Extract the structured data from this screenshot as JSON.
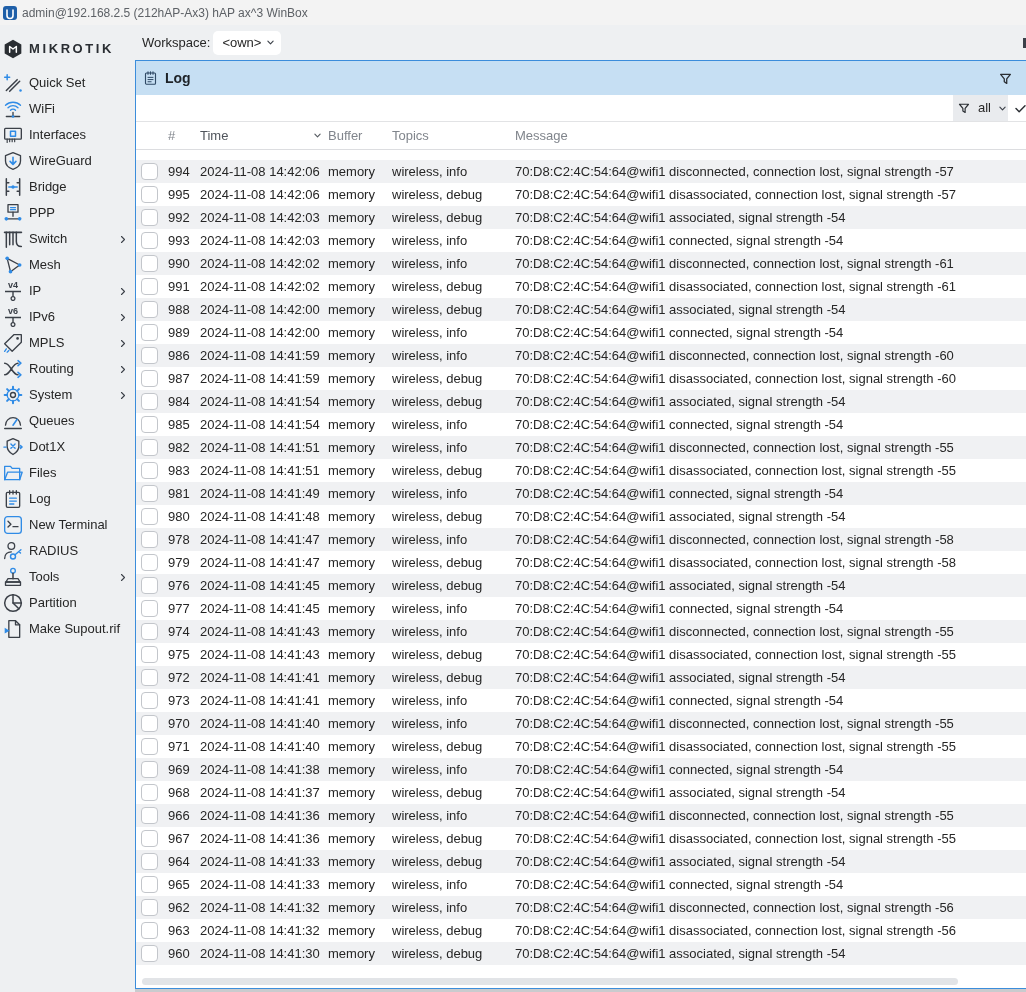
{
  "window": {
    "title": "admin@192.168.2.5 (212hAP-Ax3) hAP ax^3 WinBox"
  },
  "logo": {
    "text": "MIKROTIK"
  },
  "sidebar": {
    "items": [
      {
        "label": "Quick Set",
        "submenu": false,
        "selected": false
      },
      {
        "label": "WiFi",
        "submenu": false,
        "selected": false
      },
      {
        "label": "Interfaces",
        "submenu": false,
        "selected": false
      },
      {
        "label": "WireGuard",
        "submenu": false,
        "selected": false
      },
      {
        "label": "Bridge",
        "submenu": false,
        "selected": false
      },
      {
        "label": "PPP",
        "submenu": false,
        "selected": false
      },
      {
        "label": "Switch",
        "submenu": true,
        "selected": false
      },
      {
        "label": "Mesh",
        "submenu": false,
        "selected": false
      },
      {
        "label": "IP",
        "icon_text": "v4",
        "submenu": true,
        "selected": false
      },
      {
        "label": "IPv6",
        "icon_text": "v6",
        "submenu": true,
        "selected": false
      },
      {
        "label": "MPLS",
        "submenu": true,
        "selected": false
      },
      {
        "label": "Routing",
        "submenu": true,
        "selected": false
      },
      {
        "label": "System",
        "submenu": true,
        "selected": false
      },
      {
        "label": "Queues",
        "submenu": false,
        "selected": false
      },
      {
        "label": "Dot1X",
        "submenu": false,
        "selected": false
      },
      {
        "label": "Files",
        "submenu": false,
        "selected": false
      },
      {
        "label": "Log",
        "submenu": false,
        "selected": false
      },
      {
        "label": "New Terminal",
        "submenu": false,
        "selected": false
      },
      {
        "label": "RADIUS",
        "submenu": false,
        "selected": false
      },
      {
        "label": "Tools",
        "submenu": true,
        "selected": false
      },
      {
        "label": "Partition",
        "submenu": false,
        "selected": false
      },
      {
        "label": "Make Supout.rif",
        "submenu": false,
        "selected": false
      }
    ]
  },
  "workspace": {
    "label": "Workspace:",
    "value": "<own>"
  },
  "panel": {
    "title": "Log"
  },
  "filter": {
    "value": "all"
  },
  "table": {
    "columns": [
      {
        "label": "#",
        "sorted": false
      },
      {
        "label": "Time",
        "sorted": true
      },
      {
        "label": "Buffer",
        "sorted": false
      },
      {
        "label": "Topics",
        "sorted": false
      },
      {
        "label": "Message",
        "sorted": false
      }
    ],
    "rows": [
      {
        "number": "994",
        "time": "2024-11-08 14:42:06",
        "buffer": "memory",
        "topics": "wireless, info",
        "message": "70:D8:C2:4C:54:64@wifi1 disconnected, connection lost, signal strength -57",
        "checked": false
      },
      {
        "number": "995",
        "time": "2024-11-08 14:42:06",
        "buffer": "memory",
        "topics": "wireless, debug",
        "message": "70:D8:C2:4C:54:64@wifi1 disassociated, connection lost, signal strength -57",
        "checked": false
      },
      {
        "number": "992",
        "time": "2024-11-08 14:42:03",
        "buffer": "memory",
        "topics": "wireless, debug",
        "message": "70:D8:C2:4C:54:64@wifi1 associated, signal strength -54",
        "checked": false
      },
      {
        "number": "993",
        "time": "2024-11-08 14:42:03",
        "buffer": "memory",
        "topics": "wireless, info",
        "message": "70:D8:C2:4C:54:64@wifi1 connected, signal strength -54",
        "checked": false
      },
      {
        "number": "990",
        "time": "2024-11-08 14:42:02",
        "buffer": "memory",
        "topics": "wireless, info",
        "message": "70:D8:C2:4C:54:64@wifi1 disconnected, connection lost, signal strength -61",
        "checked": false
      },
      {
        "number": "991",
        "time": "2024-11-08 14:42:02",
        "buffer": "memory",
        "topics": "wireless, debug",
        "message": "70:D8:C2:4C:54:64@wifi1 disassociated, connection lost, signal strength -61",
        "checked": false
      },
      {
        "number": "988",
        "time": "2024-11-08 14:42:00",
        "buffer": "memory",
        "topics": "wireless, debug",
        "message": "70:D8:C2:4C:54:64@wifi1 associated, signal strength -54",
        "checked": false
      },
      {
        "number": "989",
        "time": "2024-11-08 14:42:00",
        "buffer": "memory",
        "topics": "wireless, info",
        "message": "70:D8:C2:4C:54:64@wifi1 connected, signal strength -54",
        "checked": false
      },
      {
        "number": "986",
        "time": "2024-11-08 14:41:59",
        "buffer": "memory",
        "topics": "wireless, info",
        "message": "70:D8:C2:4C:54:64@wifi1 disconnected, connection lost, signal strength -60",
        "checked": false
      },
      {
        "number": "987",
        "time": "2024-11-08 14:41:59",
        "buffer": "memory",
        "topics": "wireless, debug",
        "message": "70:D8:C2:4C:54:64@wifi1 disassociated, connection lost, signal strength -60",
        "checked": false
      },
      {
        "number": "984",
        "time": "2024-11-08 14:41:54",
        "buffer": "memory",
        "topics": "wireless, debug",
        "message": "70:D8:C2:4C:54:64@wifi1 associated, signal strength -54",
        "checked": false
      },
      {
        "number": "985",
        "time": "2024-11-08 14:41:54",
        "buffer": "memory",
        "topics": "wireless, info",
        "message": "70:D8:C2:4C:54:64@wifi1 connected, signal strength -54",
        "checked": false
      },
      {
        "number": "982",
        "time": "2024-11-08 14:41:51",
        "buffer": "memory",
        "topics": "wireless, info",
        "message": "70:D8:C2:4C:54:64@wifi1 disconnected, connection lost, signal strength -55",
        "checked": false
      },
      {
        "number": "983",
        "time": "2024-11-08 14:41:51",
        "buffer": "memory",
        "topics": "wireless, debug",
        "message": "70:D8:C2:4C:54:64@wifi1 disassociated, connection lost, signal strength -55",
        "checked": false
      },
      {
        "number": "981",
        "time": "2024-11-08 14:41:49",
        "buffer": "memory",
        "topics": "wireless, info",
        "message": "70:D8:C2:4C:54:64@wifi1 connected, signal strength -54",
        "checked": false
      },
      {
        "number": "980",
        "time": "2024-11-08 14:41:48",
        "buffer": "memory",
        "topics": "wireless, debug",
        "message": "70:D8:C2:4C:54:64@wifi1 associated, signal strength -54",
        "checked": false
      },
      {
        "number": "978",
        "time": "2024-11-08 14:41:47",
        "buffer": "memory",
        "topics": "wireless, info",
        "message": "70:D8:C2:4C:54:64@wifi1 disconnected, connection lost, signal strength -58",
        "checked": false
      },
      {
        "number": "979",
        "time": "2024-11-08 14:41:47",
        "buffer": "memory",
        "topics": "wireless, debug",
        "message": "70:D8:C2:4C:54:64@wifi1 disassociated, connection lost, signal strength -58",
        "checked": false
      },
      {
        "number": "976",
        "time": "2024-11-08 14:41:45",
        "buffer": "memory",
        "topics": "wireless, debug",
        "message": "70:D8:C2:4C:54:64@wifi1 associated, signal strength -54",
        "checked": false
      },
      {
        "number": "977",
        "time": "2024-11-08 14:41:45",
        "buffer": "memory",
        "topics": "wireless, info",
        "message": "70:D8:C2:4C:54:64@wifi1 connected, signal strength -54",
        "checked": false
      },
      {
        "number": "974",
        "time": "2024-11-08 14:41:43",
        "buffer": "memory",
        "topics": "wireless, info",
        "message": "70:D8:C2:4C:54:64@wifi1 disconnected, connection lost, signal strength -55",
        "checked": false
      },
      {
        "number": "975",
        "time": "2024-11-08 14:41:43",
        "buffer": "memory",
        "topics": "wireless, debug",
        "message": "70:D8:C2:4C:54:64@wifi1 disassociated, connection lost, signal strength -55",
        "checked": false
      },
      {
        "number": "972",
        "time": "2024-11-08 14:41:41",
        "buffer": "memory",
        "topics": "wireless, debug",
        "message": "70:D8:C2:4C:54:64@wifi1 associated, signal strength -54",
        "checked": false
      },
      {
        "number": "973",
        "time": "2024-11-08 14:41:41",
        "buffer": "memory",
        "topics": "wireless, info",
        "message": "70:D8:C2:4C:54:64@wifi1 connected, signal strength -54",
        "checked": false
      },
      {
        "number": "970",
        "time": "2024-11-08 14:41:40",
        "buffer": "memory",
        "topics": "wireless, info",
        "message": "70:D8:C2:4C:54:64@wifi1 disconnected, connection lost, signal strength -55",
        "checked": false
      },
      {
        "number": "971",
        "time": "2024-11-08 14:41:40",
        "buffer": "memory",
        "topics": "wireless, debug",
        "message": "70:D8:C2:4C:54:64@wifi1 disassociated, connection lost, signal strength -55",
        "checked": false
      },
      {
        "number": "969",
        "time": "2024-11-08 14:41:38",
        "buffer": "memory",
        "topics": "wireless, info",
        "message": "70:D8:C2:4C:54:64@wifi1 connected, signal strength -54",
        "checked": false
      },
      {
        "number": "968",
        "time": "2024-11-08 14:41:37",
        "buffer": "memory",
        "topics": "wireless, debug",
        "message": "70:D8:C2:4C:54:64@wifi1 associated, signal strength -54",
        "checked": false
      },
      {
        "number": "966",
        "time": "2024-11-08 14:41:36",
        "buffer": "memory",
        "topics": "wireless, info",
        "message": "70:D8:C2:4C:54:64@wifi1 disconnected, connection lost, signal strength -55",
        "checked": false
      },
      {
        "number": "967",
        "time": "2024-11-08 14:41:36",
        "buffer": "memory",
        "topics": "wireless, debug",
        "message": "70:D8:C2:4C:54:64@wifi1 disassociated, connection lost, signal strength -55",
        "checked": false
      },
      {
        "number": "964",
        "time": "2024-11-08 14:41:33",
        "buffer": "memory",
        "topics": "wireless, debug",
        "message": "70:D8:C2:4C:54:64@wifi1 associated, signal strength -54",
        "checked": false
      },
      {
        "number": "965",
        "time": "2024-11-08 14:41:33",
        "buffer": "memory",
        "topics": "wireless, info",
        "message": "70:D8:C2:4C:54:64@wifi1 connected, signal strength -54",
        "checked": false
      },
      {
        "number": "962",
        "time": "2024-11-08 14:41:32",
        "buffer": "memory",
        "topics": "wireless, info",
        "message": "70:D8:C2:4C:54:64@wifi1 disconnected, connection lost, signal strength -56",
        "checked": false
      },
      {
        "number": "963",
        "time": "2024-11-08 14:41:32",
        "buffer": "memory",
        "topics": "wireless, debug",
        "message": "70:D8:C2:4C:54:64@wifi1 disassociated, connection lost, signal strength -56",
        "checked": false
      },
      {
        "number": "960",
        "time": "2024-11-08 14:41:30",
        "buffer": "memory",
        "topics": "wireless, debug",
        "message": "70:D8:C2:4C:54:64@wifi1 associated, signal strength -54",
        "checked": false
      }
    ]
  }
}
